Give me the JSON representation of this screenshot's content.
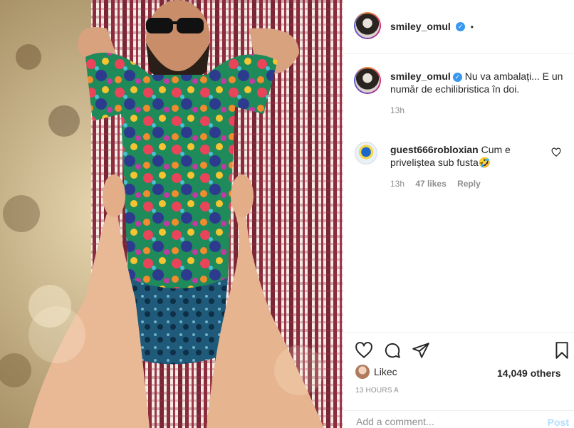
{
  "post": {
    "author": "smiley_omul",
    "header_dot": "•",
    "caption": "Nu va ambalați... E un număr de echilibristica în doi.",
    "caption_time": "13h",
    "image_alt": "Man in sunglasses and colorful tropical shirt lying on a striped blanket, photographed from above with a woman's legs in the foreground"
  },
  "comments": [
    {
      "username": "guest666robloxian",
      "text": "Cum e priveliștea sub fusta🤣",
      "time": "13h",
      "likes": "47 likes",
      "reply": "Reply"
    }
  ],
  "actions": {
    "like_icon": "heart-outline-icon",
    "comment_icon": "speech-bubble-icon",
    "share_icon": "paper-plane-icon",
    "save_icon": "bookmark-icon"
  },
  "likes": {
    "liked_prefix": "Likec",
    "others_count": "14,049 others"
  },
  "timestamp": "13 HOURS A",
  "comment_box": {
    "placeholder": "Add a comment...",
    "post_label": "Post"
  },
  "colors": {
    "verified": "#3897f0",
    "post_button": "#b2dffc",
    "text": "#262626",
    "muted": "#8e8e8e"
  }
}
